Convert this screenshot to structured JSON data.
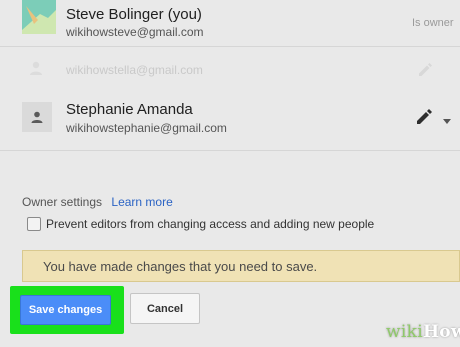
{
  "collaborators": [
    {
      "name": "Steve Bolinger (you)",
      "email": "wikihowsteve@gmail.com",
      "role_tag": "Is owner",
      "avatar": "photo-avatar",
      "faded": false
    },
    {
      "name": "",
      "email": "wikihowstella@gmail.com",
      "role_tag": "",
      "avatar": "person-icon",
      "faded": true
    },
    {
      "name": "Stephanie Amanda",
      "email": "wikihowstephanie@gmail.com",
      "role_tag": "",
      "avatar": "person-icon",
      "faded": false
    }
  ],
  "owner_settings": {
    "label": "Owner settings",
    "learn_more": "Learn more",
    "checkbox_label": "Prevent editors from changing access and adding new people",
    "checkbox_checked": false
  },
  "notice": {
    "text": "You have made changes that you need to save."
  },
  "buttons": {
    "save": "Save changes",
    "cancel": "Cancel"
  },
  "watermark": {
    "wiki": "wiki",
    "how": "How"
  },
  "colors": {
    "save_button": "#4b8df8",
    "highlight": "#19e01b",
    "notice_bg": "#f0e2b5",
    "link": "#2b63c4"
  }
}
